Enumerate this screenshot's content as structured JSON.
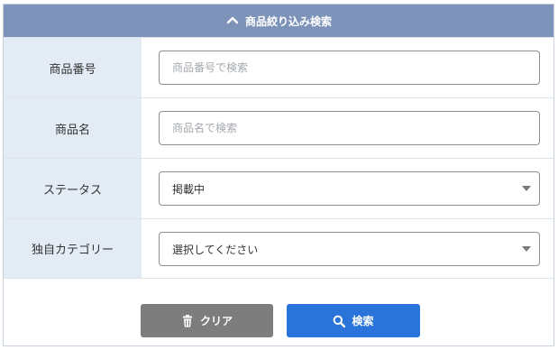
{
  "panel": {
    "title": "商品絞り込み検索",
    "toggle_icon": "chevron-up-icon"
  },
  "fields": {
    "product_number": {
      "label": "商品番号",
      "placeholder": "商品番号で検索",
      "value": ""
    },
    "product_name": {
      "label": "商品名",
      "placeholder": "商品名で検索",
      "value": ""
    },
    "status": {
      "label": "ステータス",
      "selected": "掲載中"
    },
    "category": {
      "label": "独自カテゴリー",
      "selected": "選択してください"
    }
  },
  "buttons": {
    "clear": {
      "label": "クリア",
      "icon": "trash-icon",
      "color": "#7d7d7d"
    },
    "search": {
      "label": "検索",
      "icon": "search-icon",
      "color": "#2a74d9"
    }
  },
  "colors": {
    "header": "#7d93b9",
    "label_bg": "#e3ebf5"
  }
}
